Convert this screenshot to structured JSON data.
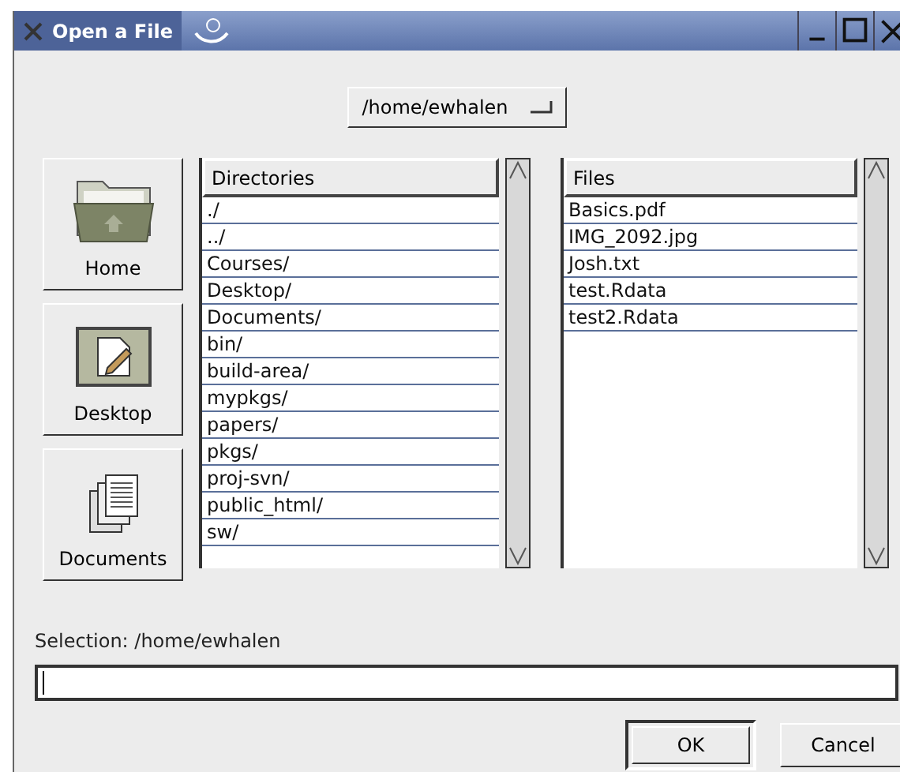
{
  "window": {
    "title": "Open a File"
  },
  "path_menu": {
    "value": "/home/ewhalen"
  },
  "shortcuts": [
    {
      "label": "Home",
      "kind": "home"
    },
    {
      "label": "Desktop",
      "kind": "desktop"
    },
    {
      "label": "Documents",
      "kind": "documents"
    }
  ],
  "directories": {
    "header": "Directories",
    "items": [
      "./",
      "../",
      "Courses/",
      "Desktop/",
      "Documents/",
      "bin/",
      "build-area/",
      "mypkgs/",
      "papers/",
      "pkgs/",
      "proj-svn/",
      "public_html/",
      "sw/"
    ]
  },
  "files": {
    "header": "Files",
    "items": [
      "Basics.pdf",
      "IMG_2092.jpg",
      "Josh.txt",
      "test.Rdata",
      "test2.Rdata"
    ]
  },
  "selection": {
    "label": "Selection: /home/ewhalen"
  },
  "buttons": [
    {
      "label": "OK",
      "default": true
    },
    {
      "label": "Cancel",
      "default": false
    }
  ]
}
